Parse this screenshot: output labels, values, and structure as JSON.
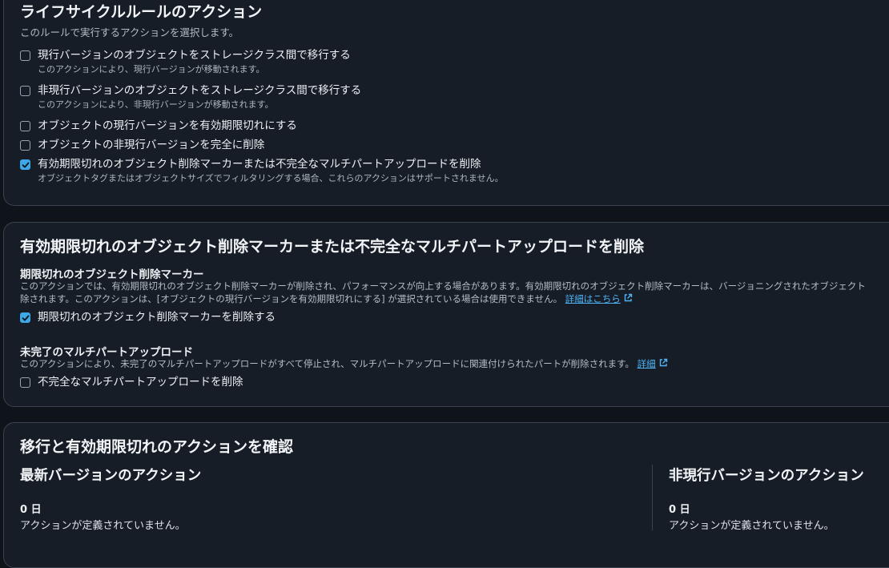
{
  "lifecycle": {
    "title": "ライフサイクルルールのアクション",
    "description": "このルールで実行するアクションを選択します。",
    "options": [
      {
        "label": "現行バージョンのオブジェクトをストレージクラス間で移行する",
        "sub": "このアクションにより、現行バージョンが移動されます。",
        "checked": false
      },
      {
        "label": "非現行バージョンのオブジェクトをストレージクラス間で移行する",
        "sub": "このアクションにより、非現行バージョンが移動されます。",
        "checked": false
      },
      {
        "label": "オブジェクトの現行バージョンを有効期限切れにする",
        "sub": "",
        "checked": false
      },
      {
        "label": "オブジェクトの非現行バージョンを完全に削除",
        "sub": "",
        "checked": false
      },
      {
        "label": "有効期限切れのオブジェクト削除マーカーまたは不完全なマルチパートアップロードを削除",
        "sub": "オブジェクトタグまたはオブジェクトサイズでフィルタリングする場合、これらのアクションはサポートされません。",
        "checked": true
      }
    ]
  },
  "delete_section": {
    "title": "有効期限切れのオブジェクト削除マーカーまたは不完全なマルチパートアップロードを削除",
    "marker": {
      "heading": "期限切れのオブジェクト削除マーカー",
      "line1": "このアクションでは、有効期限切れのオブジェクト削除マーカーが削除され、パフォーマンスが向上する場合があります。有効期限切れのオブジェクト削除マーカーは、バージョニングされたオブジェクト",
      "line2": "除されます。このアクションは、[オブジェクトの現行バージョンを有効期限切れにする] が選択されている場合は使用できません。",
      "link": "詳細はこちら",
      "checkbox_label": "期限切れのオブジェクト削除マーカーを削除する",
      "checked": true
    },
    "multipart": {
      "heading": "未完了のマルチパートアップロード",
      "line1": "このアクションにより、未完了のマルチパートアップロードがすべて停止され、マルチパートアップロードに関連付けられたパートが削除されます。",
      "link": "詳細",
      "checkbox_label": "不完全なマルチパートアップロードを削除",
      "checked": false
    }
  },
  "review": {
    "title": "移行と有効期限切れのアクションを確認",
    "current": {
      "heading": "最新バージョンのアクション",
      "value": "0 日",
      "text": "アクションが定義されていません。"
    },
    "noncurrent": {
      "heading": "非現行バージョンのアクション",
      "value": "0 日",
      "text": "アクションが定義されていません。"
    }
  },
  "colors": {
    "accent": "#3ea7e8",
    "link": "#4fb3f5",
    "panel_bg": "#161d26",
    "page_bg": "#0f141a"
  }
}
